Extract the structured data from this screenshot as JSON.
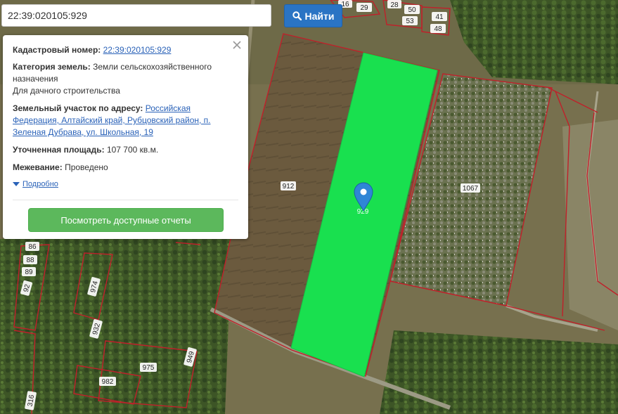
{
  "search": {
    "value": "22:39:020105:929",
    "button_label": "Найти"
  },
  "popup": {
    "cadastral_label": "Кадастровый номер:",
    "cadastral_value": "22:39:020105:929",
    "category_label": "Категория земель:",
    "category_value": "Земли сельскохозяйственного назначения",
    "category_use": "Для дачного строительства",
    "address_label": "Земельный участок по адресу:",
    "address_value": "Российская Федерация, Алтайский край, Рубцовский район, п. Зеленая Дубрава, ул. Школьная, 19",
    "area_label": "Уточненная площадь:",
    "area_value": "107 700 кв.м.",
    "survey_label": "Межевание:",
    "survey_value": "Проведено",
    "details_link": "Подробно",
    "report_button": "Посмотреть доступные отчеты"
  },
  "parcels": {
    "p912": "912",
    "p1067": "1067",
    "p929": "929",
    "p974": "974",
    "p932": "932",
    "p975": "975",
    "p949": "949",
    "p982": "982",
    "p86": "86",
    "p88": "88",
    "p89": "89",
    "p92": "92",
    "p316": "316",
    "p16": "16",
    "p29": "29",
    "p28": "28",
    "p50": "50",
    "p53": "53",
    "p41": "41",
    "p48": "48"
  },
  "colors": {
    "selected_parcel": "#19e04f",
    "parcel_border": "#c0202a",
    "accent": "#2a74c4",
    "report_button": "#5cb85c"
  }
}
